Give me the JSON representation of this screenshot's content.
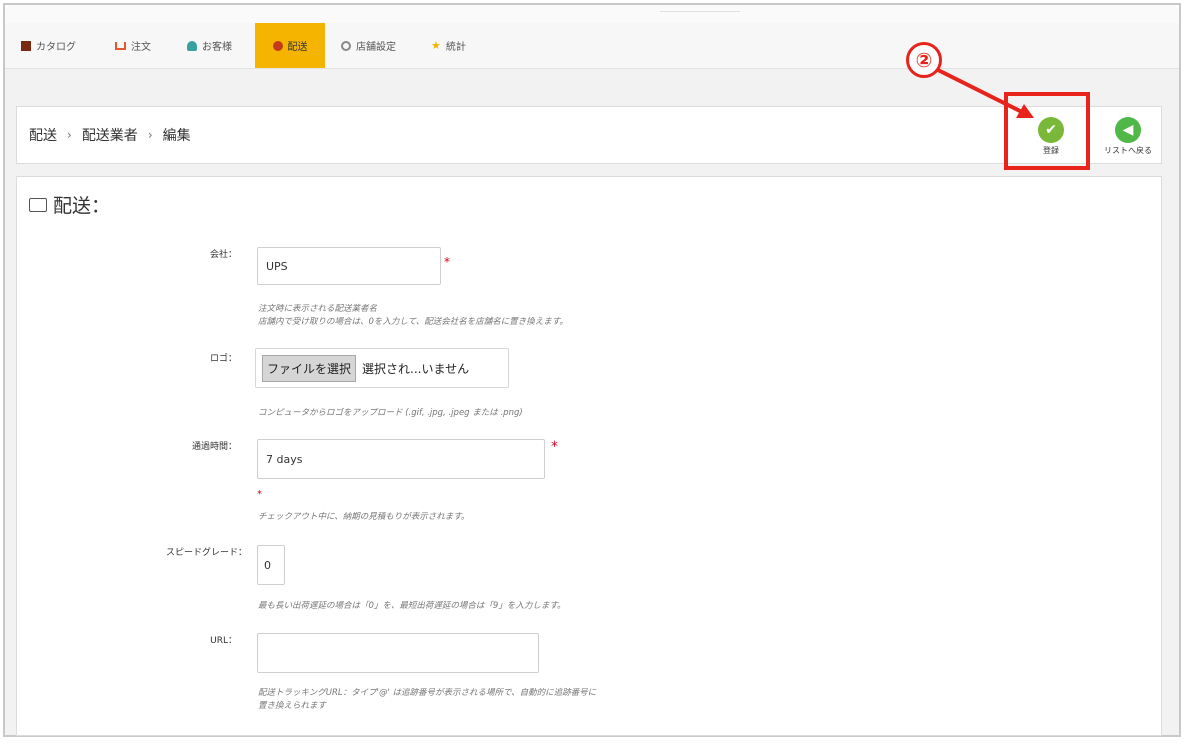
{
  "nav": {
    "items": [
      {
        "label": "カタログ",
        "icon": "book-icon"
      },
      {
        "label": "注文",
        "icon": "cart-icon"
      },
      {
        "label": "お客様",
        "icon": "user-icon"
      },
      {
        "label": "配送",
        "icon": "truck-icon",
        "active": true
      },
      {
        "label": "店舗設定",
        "icon": "gear-icon"
      },
      {
        "label": "統計",
        "icon": "star-icon"
      }
    ]
  },
  "breadcrumb": {
    "items": [
      "配送",
      "配送業者",
      "編集"
    ],
    "separator": "›"
  },
  "toolbar": {
    "save_label": "登録",
    "back_label": "リストへ戻る"
  },
  "annotation": {
    "number": "②",
    "color": "#e8231b"
  },
  "panel": {
    "title": "配送："
  },
  "form": {
    "company": {
      "label": "会社：",
      "value": "UPS",
      "required": "*",
      "help1": "注文時に表示される配送業者名",
      "help2": "店舗内で受け取りの場合は、0を入力して、配送会社名を店舗名に置き換えます。"
    },
    "logo": {
      "label": "ロゴ：",
      "button": "ファイルを選択",
      "status": "選択され...いません",
      "help": "コンピュータからロゴをアップロード (.gif, .jpg, .jpeg または .png)"
    },
    "transit": {
      "label": "通過時間：",
      "value": "7 days",
      "required": "*",
      "help": "チェックアウト中に、納期の見積もりが表示されます。"
    },
    "speed": {
      "label": "スピードグレード：",
      "value": "0",
      "help": "最も長い出荷遅延の場合は「0」を、最短出荷遅延の場合は「9」を入力します。"
    },
    "url": {
      "label": "URL：",
      "value": "",
      "help1": "配送トラッキングURL：タイプ'@' は追跡番号が表示される場所で、自動的に追跡番号に",
      "help2": "置き換えられます"
    }
  },
  "colors": {
    "accent": "#f5b400",
    "save_green": "#7ab83a",
    "back_green": "#4fb848",
    "required": "#d0021b"
  }
}
